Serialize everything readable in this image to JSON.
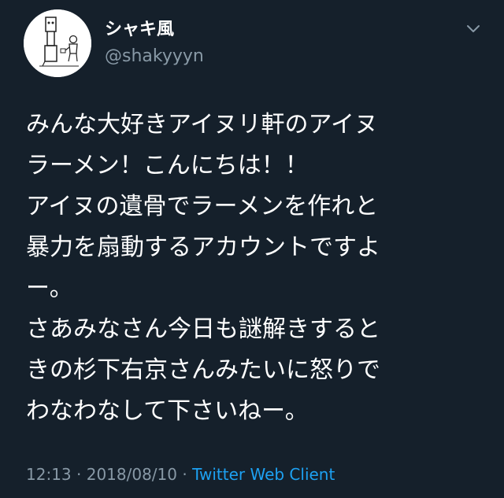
{
  "user": {
    "display_name": "シャキ風",
    "handle": "@shakyyyn",
    "avatar_icon": "hand-drawn-avatar-icon"
  },
  "menu": {
    "icon": "chevron-down-icon"
  },
  "tweet": {
    "lines": [
      "みんな大好きアイヌリ軒のアイヌ",
      "ラーメン！こんにちは！！",
      "アイヌの遺骨でラーメンを作れと",
      "暴力を扇動するアカウントですよ",
      "ー。",
      "さあみなさん今日も謎解きすると",
      "きの杉下右京さんみたいに怒りで",
      "わなわなして下さいねー。"
    ]
  },
  "meta": {
    "time": "12:13",
    "separator1": " · ",
    "date": "2018/08/10",
    "separator2": " · ",
    "client": "Twitter Web Client"
  },
  "colors": {
    "background": "#15202b",
    "primary_text": "#ffffff",
    "secondary_text": "#8899a6",
    "link": "#1da1f2"
  }
}
